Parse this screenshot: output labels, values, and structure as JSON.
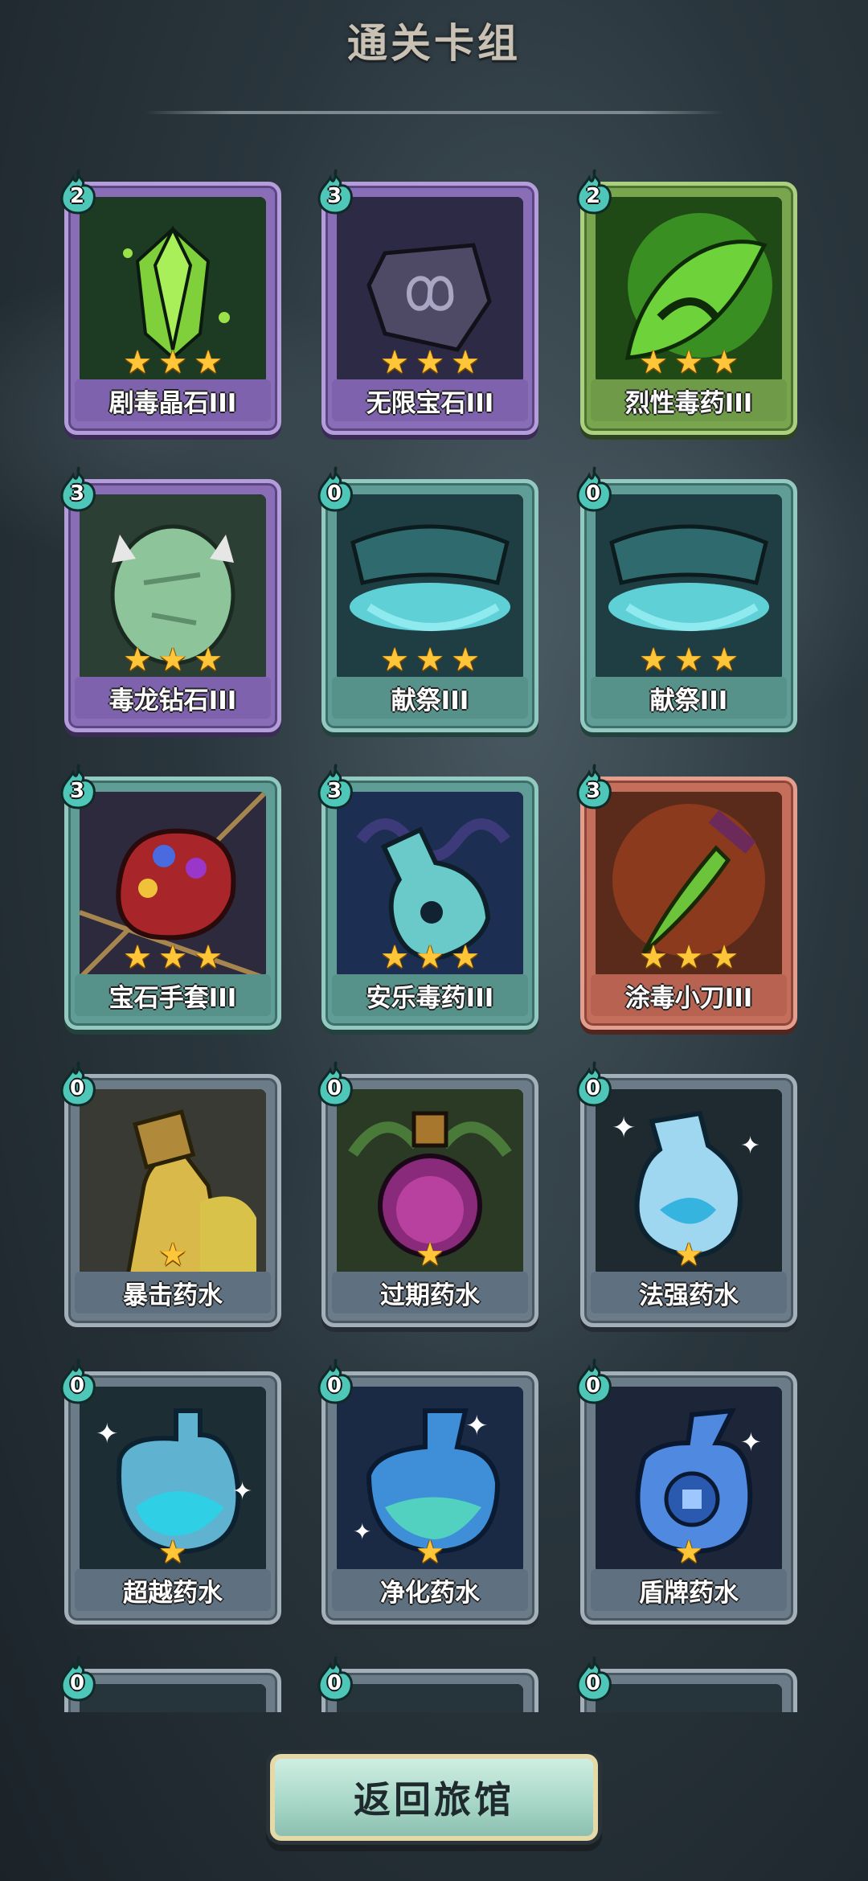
{
  "header": {
    "title": "通关卡组"
  },
  "footer": {
    "return_label": "返回旅馆"
  },
  "colors": {
    "purple": "#8a6db7",
    "green": "#79a54f",
    "teal": "#5f9d96",
    "red": "#c66e5c",
    "gray": "#6b7b88",
    "star": "#ffc63a"
  },
  "cards": [
    {
      "name": "剧毒晶石III",
      "cost": "2",
      "stars": 3,
      "rarity": "purple",
      "icon": "poison-crystal-icon"
    },
    {
      "name": "无限宝石III",
      "cost": "3",
      "stars": 3,
      "rarity": "purple",
      "icon": "infinity-gem-icon"
    },
    {
      "name": "烈性毒药III",
      "cost": "2",
      "stars": 3,
      "rarity": "green",
      "icon": "fierce-poison-icon"
    },
    {
      "name": "毒龙钻石III",
      "cost": "3",
      "stars": 3,
      "rarity": "purple",
      "icon": "dragon-diamond-icon"
    },
    {
      "name": "献祭III",
      "cost": "0",
      "stars": 3,
      "rarity": "teal",
      "icon": "sacrifice-icon"
    },
    {
      "name": "献祭III",
      "cost": "0",
      "stars": 3,
      "rarity": "teal",
      "icon": "sacrifice-icon"
    },
    {
      "name": "宝石手套III",
      "cost": "3",
      "stars": 3,
      "rarity": "teal",
      "icon": "gem-gauntlet-icon"
    },
    {
      "name": "安乐毒药III",
      "cost": "3",
      "stars": 3,
      "rarity": "teal",
      "icon": "euthanasia-poison-icon"
    },
    {
      "name": "涂毒小刀III",
      "cost": "3",
      "stars": 3,
      "rarity": "red",
      "icon": "poisoned-knife-icon"
    },
    {
      "name": "暴击药水",
      "cost": "0",
      "stars": 1,
      "rarity": "gray",
      "icon": "crit-potion-icon"
    },
    {
      "name": "过期药水",
      "cost": "0",
      "stars": 1,
      "rarity": "gray",
      "icon": "expired-potion-icon"
    },
    {
      "name": "法强药水",
      "cost": "0",
      "stars": 1,
      "rarity": "gray",
      "icon": "spell-power-potion-icon"
    },
    {
      "name": "超越药水",
      "cost": "0",
      "stars": 1,
      "rarity": "gray",
      "icon": "transcend-potion-icon"
    },
    {
      "name": "净化药水",
      "cost": "0",
      "stars": 1,
      "rarity": "gray",
      "icon": "purify-potion-icon"
    },
    {
      "name": "盾牌药水",
      "cost": "0",
      "stars": 1,
      "rarity": "gray",
      "icon": "shield-potion-icon"
    },
    {
      "name": "",
      "cost": "0",
      "stars": 0,
      "rarity": "gray",
      "icon": "card-art-icon"
    },
    {
      "name": "",
      "cost": "0",
      "stars": 0,
      "rarity": "gray",
      "icon": "card-art-icon"
    },
    {
      "name": "",
      "cost": "0",
      "stars": 0,
      "rarity": "gray",
      "icon": "card-art-icon"
    }
  ]
}
